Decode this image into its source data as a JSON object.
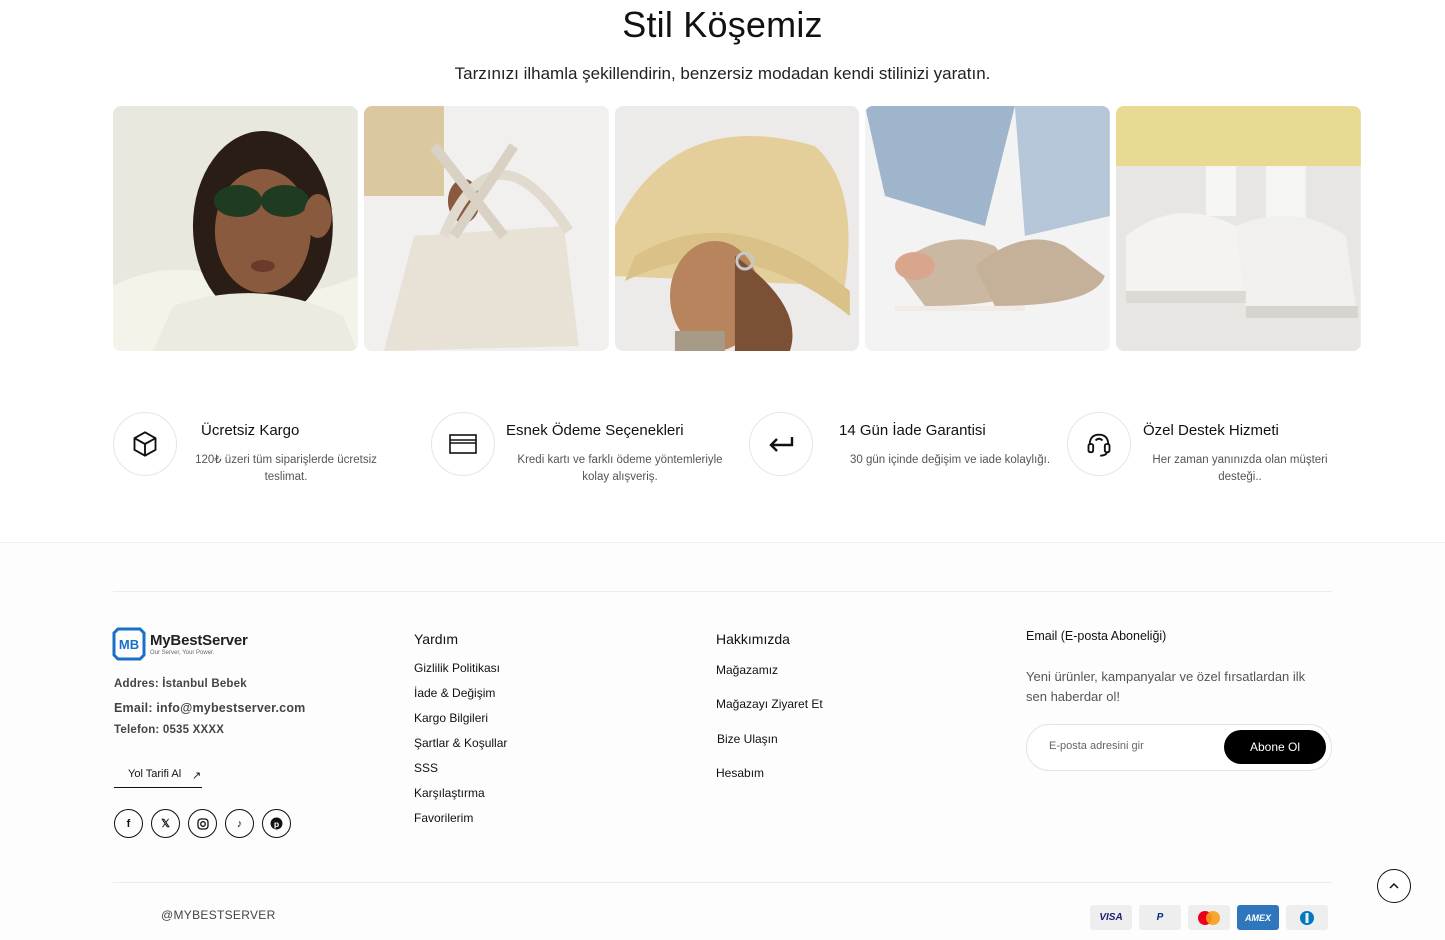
{
  "section": {
    "title": "Stil Köşemiz",
    "subtitle": "Tarzınızı ilhamla şekillendirin, benzersiz modadan kendi stilinizi yaratın."
  },
  "gallery": [
    "sunglasses-photo",
    "bag-photo",
    "hat-photo",
    "shoes-photo",
    "sneakers-photo"
  ],
  "features": [
    {
      "icon": "box-icon",
      "title": "Ücretsiz Kargo",
      "desc": "120₺ üzeri tüm siparişlerde ücretsiz teslimat."
    },
    {
      "icon": "card-icon",
      "title": "Esnek Ödeme Seçenekleri",
      "desc": "Kredi kartı ve farklı ödeme yöntemleriyle kolay alışveriş."
    },
    {
      "icon": "return-arrow-icon",
      "title": "14 Gün İade Garantisi",
      "desc": "30 gün içinde değişim ve iade kolaylığı."
    },
    {
      "icon": "headset-icon",
      "title": "Özel Destek Hizmeti",
      "desc": "Her zaman yanınızda olan müşteri desteği.."
    }
  ],
  "footer": {
    "brand": {
      "name": "MyBestServer",
      "tagline": "Our Server, Your Power."
    },
    "address": "Addres: İstanbul Bebek",
    "email": "Email: info@mybestserver.com",
    "phone": "Telefon: 0535 XXXX",
    "directions": "Yol Tarifi Al",
    "socials": [
      "facebook-icon",
      "x-icon",
      "instagram-icon",
      "tiktok-icon",
      "pinterest-icon"
    ],
    "help": {
      "title": "Yardım",
      "links": [
        "Gizlilik Politikası",
        "İade & Değişim",
        "Kargo Bilgileri",
        "Şartlar & Koşullar",
        "SSS",
        "Karşılaştırma",
        "Favorilerim"
      ]
    },
    "about": {
      "title": "Hakkımızda",
      "links": [
        "Mağazamız",
        "Mağazayı Ziyaret Et",
        "Bize Ulaşın",
        "Hesabım"
      ]
    },
    "newsletter": {
      "title": "Email (E-posta Aboneliği)",
      "desc": "Yeni ürünler, kampanyalar ve özel fırsatlardan ilk sen haberdar ol!",
      "placeholder": "E-posta adresini gir",
      "button": "Abone Ol"
    },
    "copyright": "@MYBESTSERVER",
    "payments": [
      "VISA",
      "P",
      "MC",
      "AMEX",
      "D"
    ]
  }
}
